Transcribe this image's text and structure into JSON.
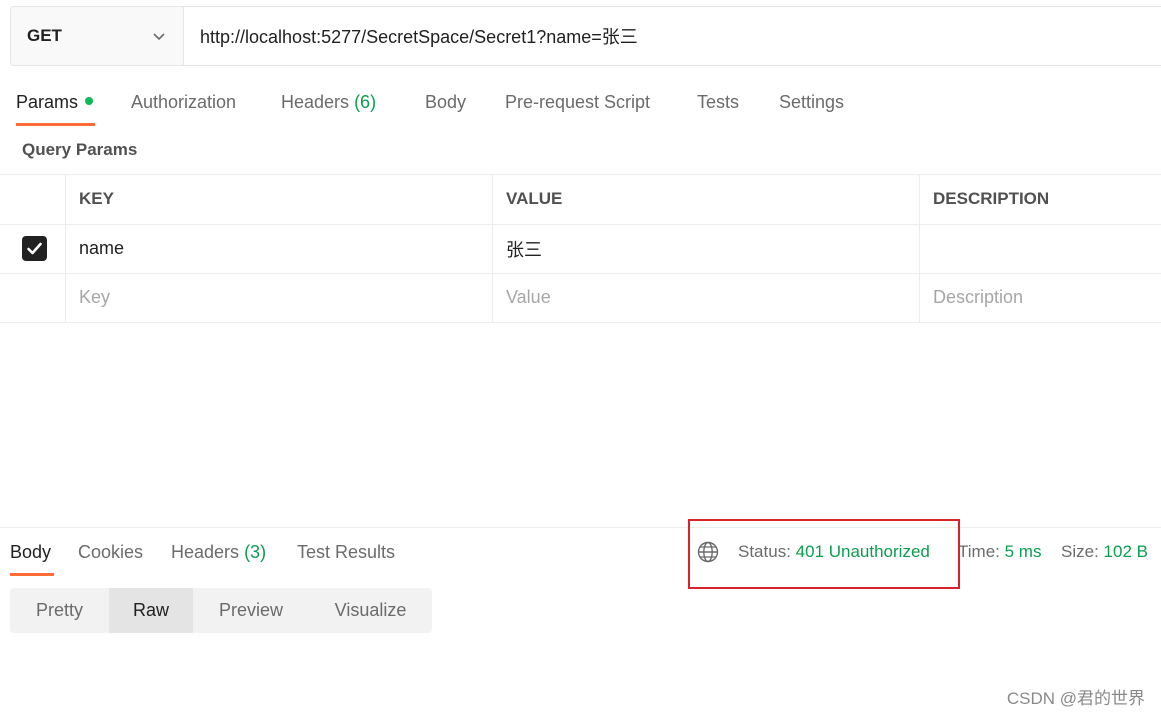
{
  "request": {
    "method": "GET",
    "url": "http://localhost:5277/SecretSpace/Secret1?name=张三"
  },
  "request_tabs": [
    {
      "label": "Params",
      "count": "",
      "active": true,
      "has_dot": true
    },
    {
      "label": "Authorization",
      "count": ""
    },
    {
      "label": "Headers",
      "count": "(6)"
    },
    {
      "label": "Body",
      "count": ""
    },
    {
      "label": "Pre-request Script",
      "count": ""
    },
    {
      "label": "Tests",
      "count": ""
    },
    {
      "label": "Settings",
      "count": ""
    }
  ],
  "query_params": {
    "title": "Query Params",
    "columns": [
      "KEY",
      "VALUE",
      "DESCRIPTION"
    ],
    "rows": [
      {
        "checked": true,
        "key": "name",
        "value": "张三",
        "description": ""
      }
    ],
    "placeholder": {
      "key": "Key",
      "value": "Value",
      "description": "Description"
    }
  },
  "response_tabs": [
    {
      "label": "Body",
      "count": "",
      "active": true
    },
    {
      "label": "Cookies",
      "count": ""
    },
    {
      "label": "Headers",
      "count": "(3)"
    },
    {
      "label": "Test Results",
      "count": ""
    }
  ],
  "response_meta": {
    "status_label": "Status:",
    "status_value": "401 Unauthorized",
    "time_label": "Time:",
    "time_value": "5 ms",
    "size_label": "Size:",
    "size_value": "102 B"
  },
  "view_modes": [
    {
      "label": "Pretty"
    },
    {
      "label": "Raw",
      "active": true
    },
    {
      "label": "Preview"
    },
    {
      "label": "Visualize"
    }
  ],
  "watermark": "CSDN @君的世界",
  "colors": {
    "accent": "#ff6c37",
    "success": "#0b9e4e",
    "highlight": "#d9232b"
  }
}
